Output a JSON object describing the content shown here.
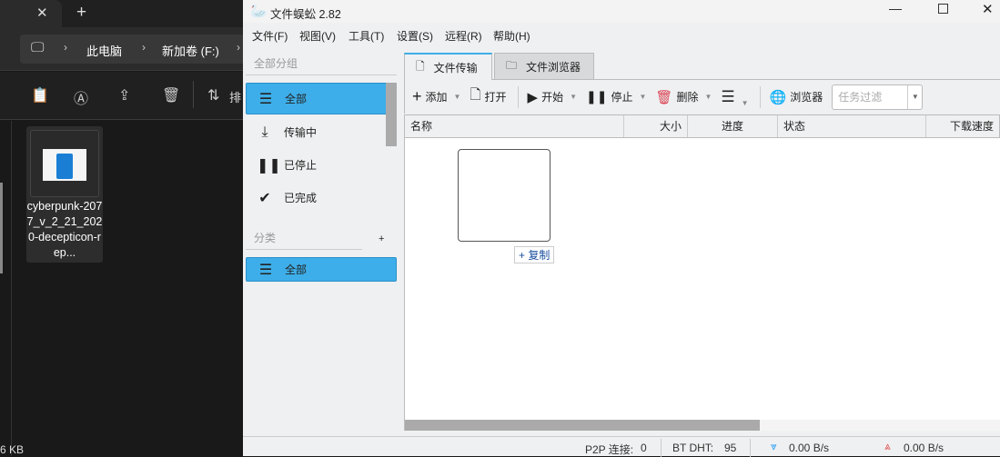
{
  "explorer": {
    "breadcrumb": [
      "此电脑",
      "新加卷 (F:)"
    ],
    "sort_label": "排",
    "file_name": "cyberpunk-2077_v_2_21_2020-decepticon-rep...",
    "size_text": "6 KB"
  },
  "app": {
    "title": "文件蜈蚣 2.82",
    "menu": [
      "文件(F)",
      "视图(V)",
      "工具(T)",
      "设置(S)",
      "远程(R)",
      "帮助(H)"
    ],
    "sidebar": {
      "group_header": "全部分组",
      "items": [
        {
          "label": "全部",
          "selected": true
        },
        {
          "label": "传输中"
        },
        {
          "label": "已停止"
        },
        {
          "label": "已完成"
        }
      ],
      "category_header": "分类",
      "category_add": "+",
      "category_items": [
        {
          "label": "全部",
          "selected": true
        }
      ]
    },
    "tabs": [
      {
        "label": "文件传输",
        "active": true
      },
      {
        "label": "文件浏览器"
      }
    ],
    "toolbar": {
      "add": "添加",
      "open": "打开",
      "start": "开始",
      "stop": "停止",
      "delete": "删除",
      "browser": "浏览器",
      "filter_placeholder": "任务过滤"
    },
    "columns": [
      "名称",
      "大小",
      "进度",
      "状态",
      "下载速度"
    ],
    "drag_hint": "+ 复制",
    "status": {
      "p2p_label": "P2P 连接:",
      "p2p_value": "0",
      "dht_label": "BT DHT:",
      "dht_value": "95",
      "down_speed": "0.00 B/s",
      "up_speed": "0.00 B/s"
    },
    "colors": {
      "accent": "#3daee9",
      "delete": "#da4453",
      "down": "#1d99f3",
      "up": "#e05050"
    }
  }
}
